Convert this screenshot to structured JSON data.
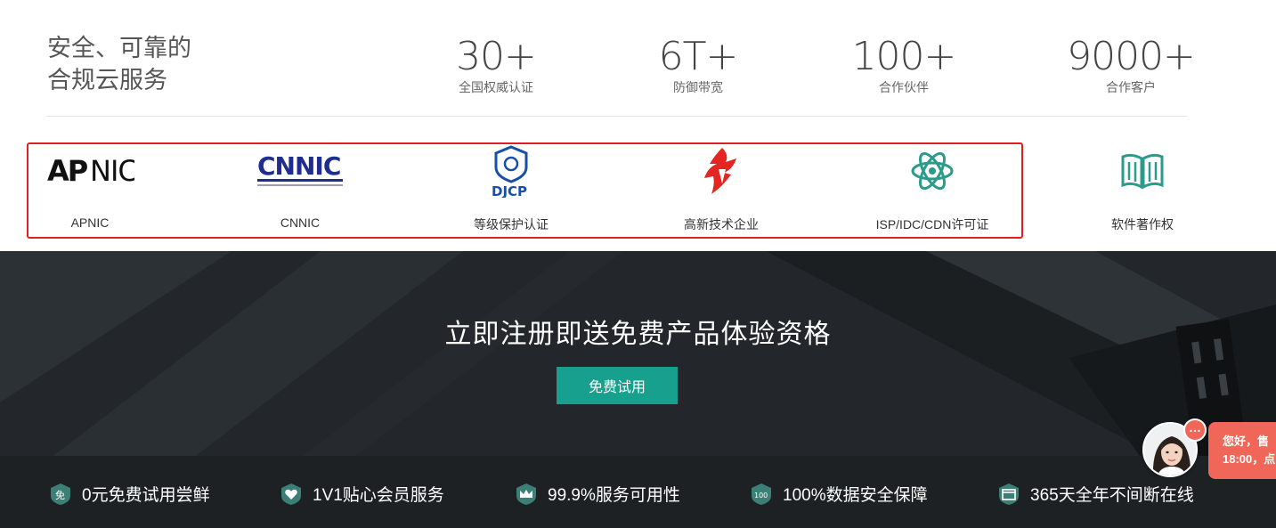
{
  "stats": {
    "tagline_line1": "安全、可靠的",
    "tagline_line2": "合规云服务",
    "items": [
      {
        "value": "30+",
        "label": "全国权威认证"
      },
      {
        "value": "6T+",
        "label": "防御带宽"
      },
      {
        "value": "100+",
        "label": "合作伙伴"
      },
      {
        "value": "9000+",
        "label": "合作客户"
      }
    ]
  },
  "certs": [
    {
      "icon": "apnic-logo",
      "logo_text": "APNIC",
      "name": "APNIC"
    },
    {
      "icon": "cnnic-logo",
      "logo_text": "CNNIC",
      "name": "CNNIC"
    },
    {
      "icon": "djcp-logo",
      "logo_text": "DJCP",
      "name": "等级保护认证"
    },
    {
      "icon": "high-tech-logo",
      "name": "高新技术企业"
    },
    {
      "icon": "atom-icon",
      "name": "ISP/IDC/CDN许可证"
    },
    {
      "icon": "book-icon",
      "name": "软件著作权"
    }
  ],
  "banner": {
    "title": "立即注册即送免费产品体验资格",
    "button_label": "免费试用",
    "button_color": "#17a08e"
  },
  "features": [
    {
      "icon": "free-icon",
      "label": "0元免费试用尝鲜"
    },
    {
      "icon": "heart-icon",
      "label": "1V1贴心会员服务"
    },
    {
      "icon": "crown-icon",
      "label": "99.9%服务可用性"
    },
    {
      "icon": "shield-100-icon",
      "label": "100%数据安全保障"
    },
    {
      "icon": "calendar-icon",
      "label": "365天全年不间断在线"
    }
  ],
  "chat": {
    "line1": "您好，售",
    "line2": "18:00，点",
    "accent": "#f0675a"
  },
  "colors": {
    "highlight_border": "#e02020",
    "teal": "#17a08e"
  }
}
